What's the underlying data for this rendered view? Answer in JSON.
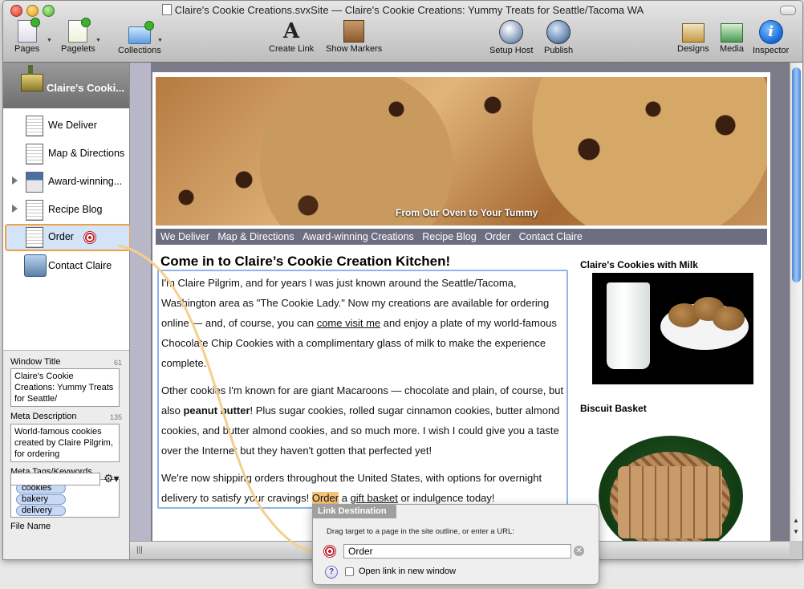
{
  "window": {
    "title": "Claire's Cookie Creations.svxSite — Claire's Cookie Creations: Yummy Treats for Seattle/Tacoma WA"
  },
  "toolbar": {
    "pages": "Pages",
    "pagelets": "Pagelets",
    "collections": "Collections",
    "create_link": "Create Link",
    "show_markers": "Show Markers",
    "setup_host": "Setup Host",
    "publish": "Publish",
    "designs": "Designs",
    "media": "Media",
    "inspector": "Inspector",
    "inspector_glyph": "i"
  },
  "sidebar": {
    "site_title": "Claire's Cooki...",
    "items": [
      {
        "label": "We Deliver"
      },
      {
        "label": "Map & Directions"
      },
      {
        "label": "Award-winning..."
      },
      {
        "label": "Recipe Blog"
      },
      {
        "label": "Order"
      },
      {
        "label": "Contact Claire"
      }
    ]
  },
  "properties": {
    "window_title_label": "Window Title",
    "window_title_count": "61",
    "window_title_value": "Claire's Cookie Creations: Yummy Treats for Seattle/",
    "meta_description_label": "Meta Description",
    "meta_description_count": "135",
    "meta_description_value": "World-famous cookies created by Claire Pilgrim, for ordering",
    "meta_tags_label": "Meta Tags/Keywords",
    "tags": [
      "cookies",
      "bakery",
      "delivery"
    ],
    "file_name_label": "File Name",
    "gear_glyph": "⚙▾"
  },
  "webpage": {
    "hero_tagline": "From Our Oven to Your Tummy",
    "nav": [
      "We Deliver",
      "Map & Directions",
      "Award-winning Creations",
      "Recipe Blog",
      "Order",
      "Contact Claire"
    ],
    "heading": "Come in to Claire’s Cookie Creation Kitchen!",
    "p1_a": "I'm Claire Pilgrim, and for years I was just known around the Seattle/Tacoma, Washington area as \"The Cookie Lady.\" Now my creations are available for ordering online — and, of course, you can ",
    "p1_link": "come visit me",
    "p1_b": " and enjoy a plate of my world-famous Chocolate Chip Cookies with a complimentary glass of milk to make the experience complete.",
    "p2_a": "Other cookies I'm known for are giant Macaroons — chocolate and plain, of course, but also ",
    "p2_bold": "peanut butter",
    "p2_b": "! Plus sugar cookies, rolled sugar cinnamon cookies, butter almond cookies, and butter almond cookies, and so much more. I wish I could give you a taste over the Internet but they haven't gotten that perfected yet!",
    "p3_a": "We're now shipping orders throughout the United States, with options for overnight delivery to satisfy your cravings! ",
    "p3_hl": "Order",
    "p3_b": " a ",
    "p3_link": "gift basket",
    "p3_c": " or indulgence today!",
    "side1_title": "Claire's Cookies with Milk",
    "side2_title": "Biscuit Basket"
  },
  "popover": {
    "tab": "Link Destination",
    "hint": "Drag target to a page in the site outline, or enter a URL:",
    "value": "Order",
    "clear_glyph": "✕",
    "help_glyph": "?",
    "checkbox_label": "Open link in new window"
  },
  "statusbar": {
    "grip": "|||"
  },
  "colors": {
    "selection_outline": "#f0a044",
    "sidebar_header": "#7e7e7e",
    "site_nav": "#6e6e82",
    "edit_box": "#8fb4ea",
    "link_curve": "#f4cf8e"
  }
}
